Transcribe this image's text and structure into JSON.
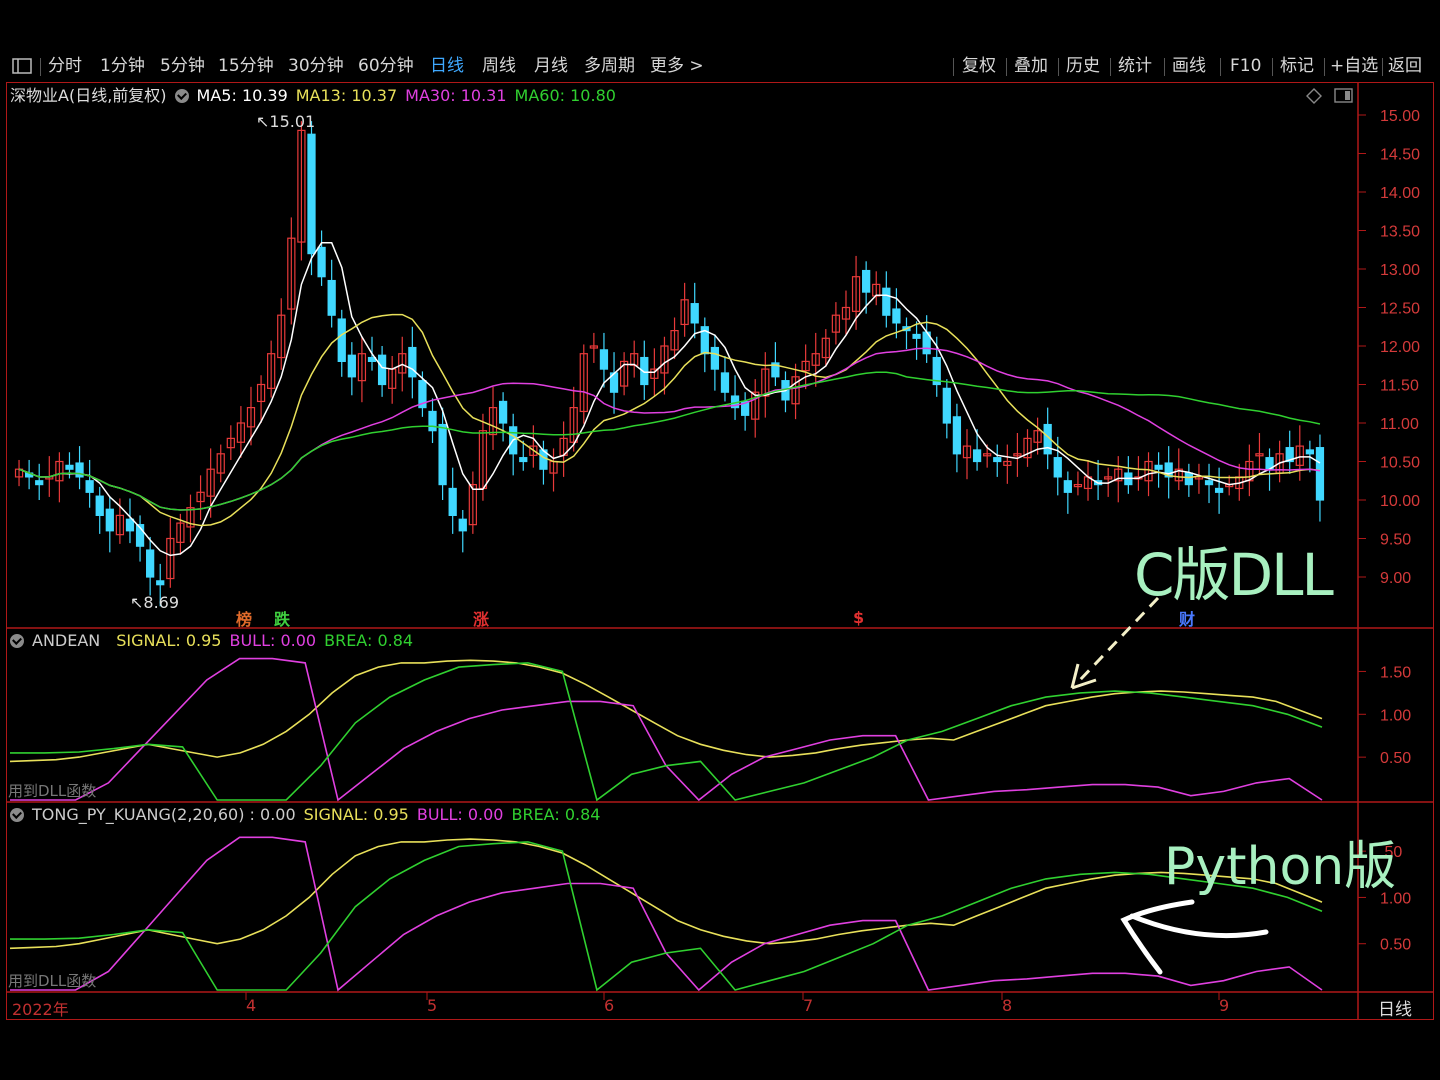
{
  "toolbar": {
    "left_icon": "layout-icon",
    "periods": [
      "分时",
      "1分钟",
      "5分钟",
      "15分钟",
      "30分钟",
      "60分钟",
      "日线",
      "周线",
      "月线",
      "多周期",
      "更多 >"
    ],
    "active_period": "日线",
    "right_items": [
      "复权",
      "叠加",
      "历史",
      "统计",
      "画线",
      "F10",
      "标记",
      "+自选",
      "返回"
    ]
  },
  "main": {
    "title": "深物业A(日线,前复权)",
    "ma": [
      {
        "label": "MA5: 10.39",
        "color": "#ffffff"
      },
      {
        "label": "MA13: 10.37",
        "color": "#e8e05a"
      },
      {
        "label": "MA30: 10.31",
        "color": "#e040e0"
      },
      {
        "label": "MA60: 10.80",
        "color": "#30d030"
      }
    ],
    "y_ticks": [
      "15.00",
      "14.50",
      "14.00",
      "13.50",
      "13.00",
      "12.50",
      "12.00",
      "11.50",
      "11.00",
      "10.50",
      "10.00",
      "9.50",
      "9.00"
    ],
    "high_label": "15.01",
    "low_label": "8.69",
    "markers": [
      {
        "text": "榜",
        "color": "#e06a2a"
      },
      {
        "text": "跌",
        "color": "#40d040"
      },
      {
        "text": "涨",
        "color": "#e03030"
      },
      {
        "text": "$",
        "color": "#e03030"
      },
      {
        "text": "财",
        "color": "#4a7aff"
      }
    ]
  },
  "panel1": {
    "name": "ANDEAN",
    "signal": "SIGNAL: 0.95",
    "bull": "BULL: 0.00",
    "brea": "BREA: 0.84",
    "y_ticks": [
      "1.50",
      "1.00",
      "0.50"
    ],
    "footnote": "用到DLL函数"
  },
  "panel2": {
    "name": "TONG_PY_KUANG(2,20,60) : 0.00",
    "signal": "SIGNAL: 0.95",
    "bull": "BULL: 0.00",
    "brea": "BREA: 0.84",
    "y_ticks": [
      ".50",
      "1.00",
      "0.50"
    ],
    "footnote": "用到DLL函数"
  },
  "x_axis": {
    "labels": [
      "2022年",
      "4",
      "5",
      "6",
      "7",
      "8",
      "9"
    ],
    "period_label": "日线"
  },
  "annotations": {
    "c_version": "C版DLL",
    "python_version": "Python版"
  },
  "colors": {
    "up": "#e83a3a",
    "down": "#40d8ff",
    "ma5": "#ffffff",
    "ma13": "#e8e05a",
    "ma30": "#e040e0",
    "ma60": "#30d030",
    "signal": "#e8e05a",
    "bull": "#e040e0",
    "brea": "#30d030",
    "frame": "#b01818",
    "annotation": "#a8f0c0",
    "active": "#3fa9ff"
  },
  "chart_data": {
    "type": "candlestick",
    "ylim": [
      8.5,
      15.2
    ],
    "close": [
      10.4,
      10.3,
      10.2,
      10.3,
      10.5,
      10.4,
      10.3,
      10.1,
      9.8,
      9.6,
      9.8,
      9.6,
      9.4,
      9.0,
      8.9,
      9.5,
      9.7,
      9.9,
      10.1,
      10.4,
      10.6,
      10.8,
      11.0,
      11.2,
      11.5,
      11.9,
      12.4,
      13.4,
      14.8,
      13.2,
      12.9,
      12.4,
      11.8,
      11.6,
      11.9,
      11.8,
      11.5,
      11.7,
      11.9,
      11.6,
      11.2,
      10.9,
      10.2,
      9.8,
      9.6,
      10.2,
      10.9,
      11.2,
      11.0,
      10.6,
      10.5,
      10.7,
      10.4,
      10.5,
      10.8,
      11.2,
      11.9,
      12.0,
      11.7,
      11.4,
      11.8,
      11.9,
      11.5,
      11.7,
      12.0,
      12.2,
      12.6,
      12.3,
      11.9,
      11.7,
      11.4,
      11.2,
      11.1,
      11.4,
      11.7,
      11.6,
      11.3,
      11.6,
      11.8,
      11.9,
      12.1,
      12.4,
      12.5,
      12.9,
      12.7,
      12.8,
      12.4,
      12.3,
      12.2,
      12.1,
      11.9,
      11.5,
      11.0,
      10.6,
      10.7,
      10.5,
      10.6,
      10.5,
      10.5,
      10.6,
      10.8,
      10.9,
      10.6,
      10.3,
      10.1,
      10.2,
      10.3,
      10.2,
      10.3,
      10.4,
      10.2,
      10.3,
      10.5,
      10.4,
      10.3,
      10.4,
      10.2,
      10.3,
      10.2,
      10.1,
      10.2,
      10.3,
      10.5,
      10.6,
      10.4,
      10.6,
      10.5,
      10.7,
      10.6,
      10.0
    ],
    "andean_signal": [
      0.45,
      0.46,
      0.47,
      0.5,
      0.55,
      0.6,
      0.65,
      0.6,
      0.55,
      0.5,
      0.55,
      0.65,
      0.8,
      1.0,
      1.25,
      1.45,
      1.55,
      1.6,
      1.6,
      1.62,
      1.63,
      1.62,
      1.6,
      1.55,
      1.48,
      1.35,
      1.2,
      1.05,
      0.9,
      0.75,
      0.65,
      0.58,
      0.53,
      0.5,
      0.52,
      0.55,
      0.6,
      0.64,
      0.67,
      0.7,
      0.72,
      0.7,
      0.8,
      0.9,
      1.0,
      1.1,
      1.15,
      1.2,
      1.24,
      1.26,
      1.27,
      1.26,
      1.24,
      1.22,
      1.2,
      1.15,
      1.05,
      0.95
    ],
    "andean_bull": [
      0.0,
      0.0,
      0.0,
      0.2,
      0.6,
      1.0,
      1.4,
      1.65,
      1.65,
      1.6,
      0.0,
      0.3,
      0.6,
      0.8,
      0.95,
      1.05,
      1.1,
      1.15,
      1.15,
      1.1,
      0.4,
      0.0,
      0.3,
      0.5,
      0.6,
      0.7,
      0.75,
      0.75,
      0.0,
      0.05,
      0.1,
      0.12,
      0.15,
      0.18,
      0.18,
      0.15,
      0.05,
      0.1,
      0.2,
      0.25,
      0.0
    ],
    "andean_brea": [
      0.55,
      0.55,
      0.56,
      0.6,
      0.65,
      0.62,
      0.0,
      0.0,
      0.0,
      0.4,
      0.9,
      1.2,
      1.4,
      1.55,
      1.58,
      1.6,
      1.5,
      0.0,
      0.3,
      0.4,
      0.45,
      0.0,
      0.1,
      0.2,
      0.35,
      0.5,
      0.7,
      0.8,
      0.95,
      1.1,
      1.2,
      1.25,
      1.27,
      1.25,
      1.2,
      1.15,
      1.1,
      1.0,
      0.85
    ]
  }
}
